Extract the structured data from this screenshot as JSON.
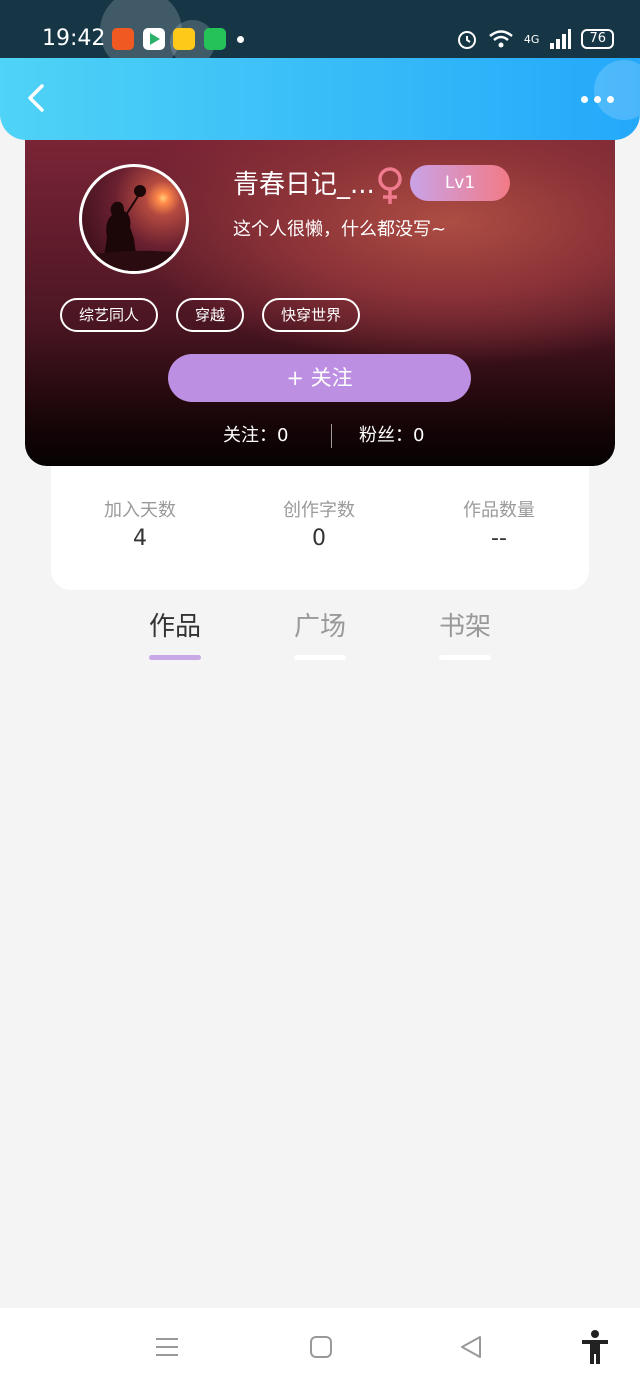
{
  "status_bar": {
    "time": "19:42",
    "battery": "76",
    "network": "4G"
  },
  "header": {
    "back_icon": "chevron-left-icon",
    "more_icon": "more-horizontal-icon"
  },
  "profile": {
    "username": "青春日记_...",
    "gender_icon": "female-icon",
    "gender_color": "#f07a8e",
    "level": "Lv1",
    "bio": "这个人很懒，什么都没写~",
    "tags": [
      "综艺同人",
      "穿越",
      "快穿世界"
    ],
    "follow_label": "+  关注",
    "following_text": "关注：0",
    "followers_text": "粉丝：0"
  },
  "stats": [
    {
      "label": "加入天数",
      "value": "4"
    },
    {
      "label": "创作字数",
      "value": "0"
    },
    {
      "label": "作品数量",
      "value": "--"
    }
  ],
  "tabs": [
    {
      "label": "作品",
      "active": true
    },
    {
      "label": "广场",
      "active": false
    },
    {
      "label": "书架",
      "active": false
    }
  ],
  "colors": {
    "header_start": "#4fd3f6",
    "header_end": "#24a8fa",
    "accent_purple": "#bd8fe3",
    "tab_underline_active": "#c8a8e6"
  },
  "nav_bar": {
    "icons": [
      "menu-icon",
      "home-square-icon",
      "back-triangle-icon",
      "accessibility-icon"
    ]
  }
}
